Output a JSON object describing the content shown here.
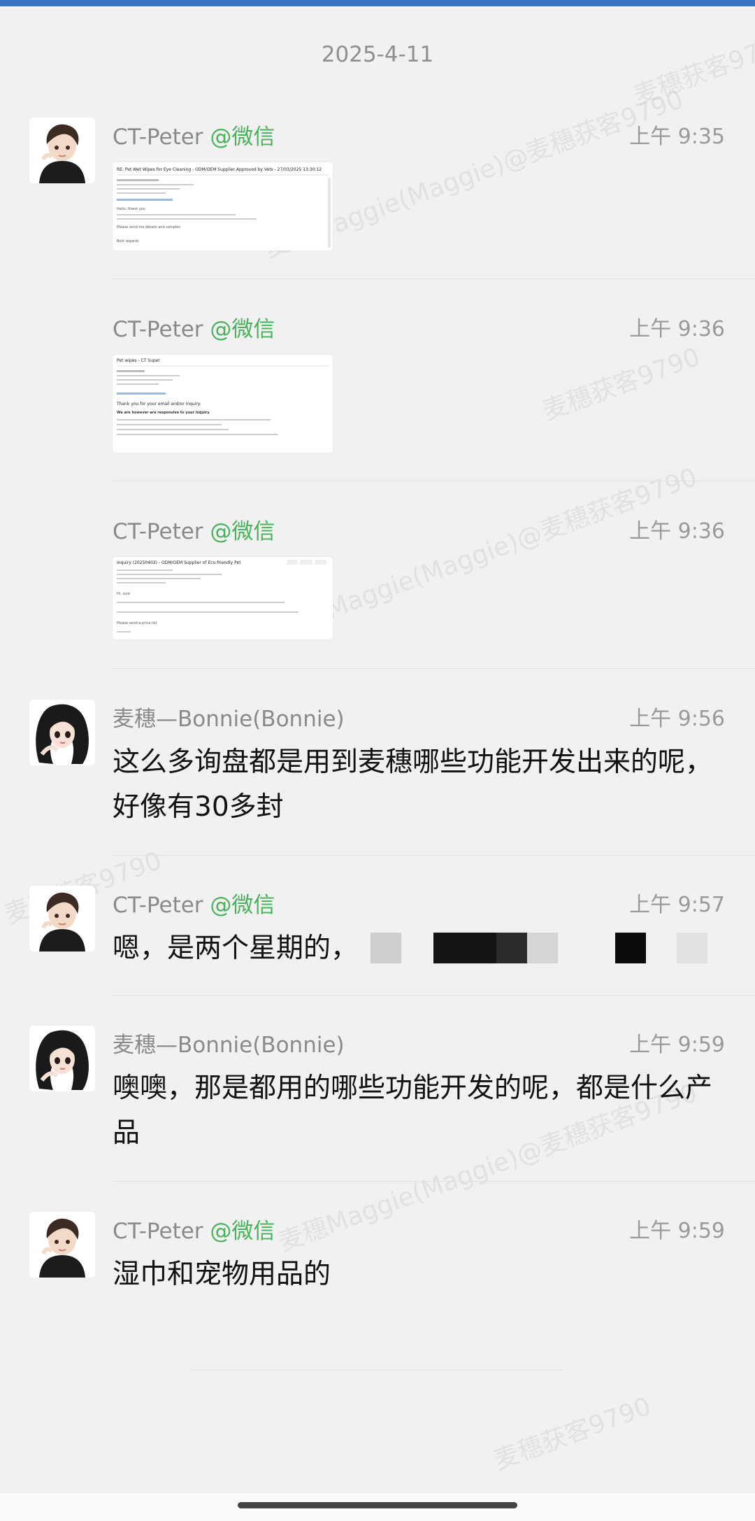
{
  "chat": {
    "date": "2025-4-11",
    "wechat_tag": "@微信",
    "messages": [
      {
        "sender": "CT-Peter",
        "time": "上午 9:35"
      },
      {
        "sender": "CT-Peter",
        "time": "上午 9:36"
      },
      {
        "sender": "CT-Peter",
        "time": "上午 9:36"
      },
      {
        "sender": "麦穗—Bonnie(Bonnie)",
        "time": "上午 9:56",
        "text": "这么多询盘都是用到麦穗哪些功能开发出来的呢，好像有30多封"
      },
      {
        "sender": "CT-Peter",
        "time": "上午 9:57",
        "text": "嗯，是两个星期的，"
      },
      {
        "sender": "麦穗—Bonnie(Bonnie)",
        "time": "上午 9:59",
        "text": "噢噢，那是都用的哪些功能开发的呢，都是什么产品"
      },
      {
        "sender": "CT-Peter",
        "time": "上午 9:59",
        "text": "湿巾和宠物用品的"
      }
    ],
    "thumbnails": [
      {
        "subject": "RE: Pet Wet Wipes for Eye Cleaning - ODM/OEM Supplier Approved by Vets - 27/03/2025 13:30:12",
        "body_lines": [
          "Hello, thank you",
          "Please send me details and samples",
          "Best regards"
        ]
      },
      {
        "subject": "Pet wipes - CT Super",
        "body_lines": [
          "Thank you for your email and/or inquiry.",
          "We are however are responsive to your inquiry"
        ]
      },
      {
        "subject": "Inquiry (20250403) - ODM/OEM Supplier of Eco-friendly Pet",
        "body_lines": [
          "Hi, sure",
          "Please send a price list"
        ]
      }
    ]
  },
  "watermark": {
    "text": "麦穗获客9790",
    "alt_text": "麦穗Maggie(Maggie)@麦穗获客9790"
  }
}
